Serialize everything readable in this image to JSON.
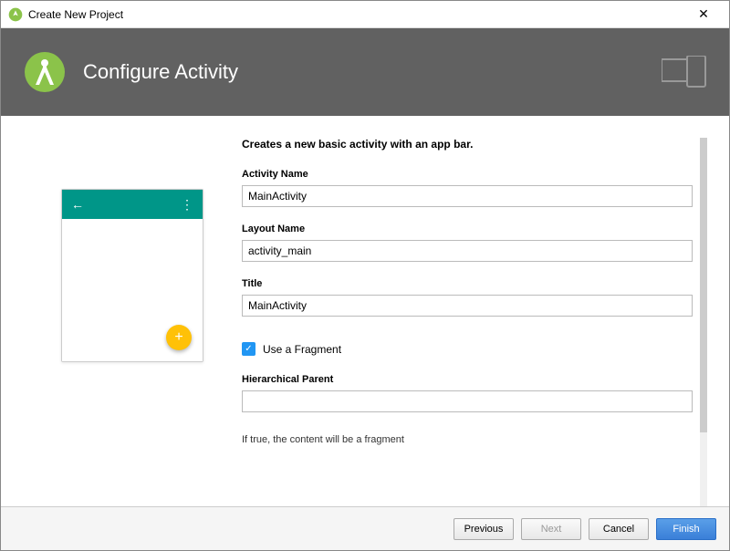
{
  "window": {
    "title": "Create New Project"
  },
  "header": {
    "title": "Configure Activity"
  },
  "form": {
    "description": "Creates a new basic activity with an app bar.",
    "activity_name_label": "Activity Name",
    "activity_name_value": "MainActivity",
    "layout_name_label": "Layout Name",
    "layout_name_value": "activity_main",
    "title_label": "Title",
    "title_value": "MainActivity",
    "use_fragment_label": "Use a Fragment",
    "use_fragment_checked": true,
    "hierarchical_parent_label": "Hierarchical Parent",
    "hierarchical_parent_value": "",
    "hint": "If true, the content will be a fragment"
  },
  "footer": {
    "previous": "Previous",
    "next": "Next",
    "cancel": "Cancel",
    "finish": "Finish"
  }
}
